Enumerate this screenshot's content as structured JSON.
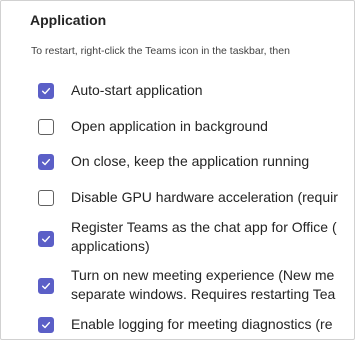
{
  "section": {
    "title": "Application",
    "hint": "To restart, right-click the Teams icon in the taskbar, then"
  },
  "options": [
    {
      "label": "Auto-start application",
      "checked": true
    },
    {
      "label": "Open application in background",
      "checked": false
    },
    {
      "label": "On close, keep the application running",
      "checked": true
    },
    {
      "label": "Disable GPU hardware acceleration (requir",
      "checked": false
    },
    {
      "label": "Register Teams as the chat app for Office (\napplications)",
      "checked": true
    },
    {
      "label": "Turn on new meeting experience (New me\nseparate windows. Requires restarting Tea",
      "checked": true
    },
    {
      "label": "Enable logging for meeting diagnostics (re",
      "checked": true
    }
  ],
  "colors": {
    "checked": "#5b5fc7",
    "unchecked_border": "#616161"
  }
}
